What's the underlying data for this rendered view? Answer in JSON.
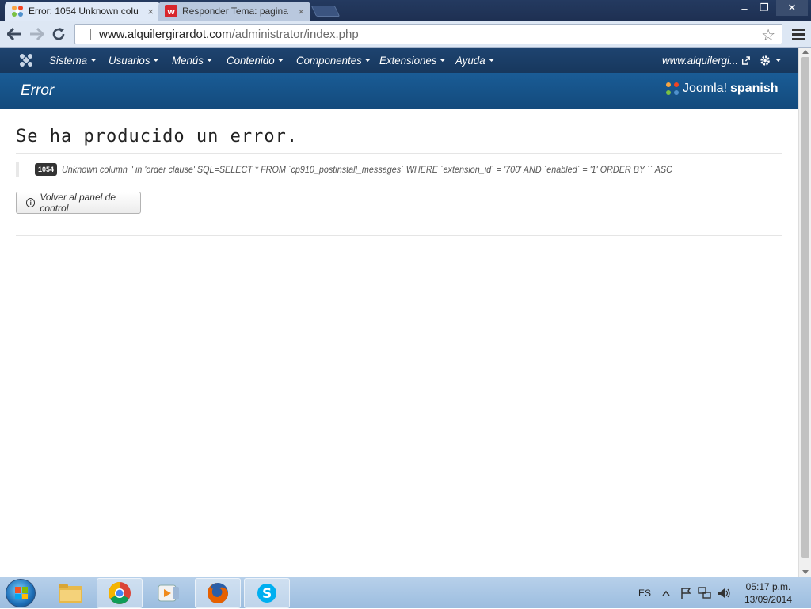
{
  "browser": {
    "tabs": [
      {
        "title": "Error: 1054 Unknown colu",
        "close": "×"
      },
      {
        "title": "Responder Tema: pagina",
        "close": "×"
      }
    ],
    "window_controls": {
      "minimize": "–",
      "maximize": "❐",
      "close": "✕"
    },
    "url_host": "www.alquilergirardot.com",
    "url_path": "/administrator/index.php"
  },
  "joomla_nav": {
    "items": [
      "Sistema",
      "Usuarios",
      "Menús",
      "Contenido",
      "Componentes",
      "Extensiones",
      "Ayuda"
    ],
    "site_link": "www.alquilergi..."
  },
  "subheader": {
    "title": "Error",
    "logo_text_1": "Joomla!",
    "logo_text_2": "spanish"
  },
  "error": {
    "heading": "Se ha producido un error.",
    "code": "1054",
    "message": "Unknown column '' in 'order clause' SQL=SELECT * FROM `cp910_postinstall_messages` WHERE `extension_id` = '700' AND `enabled` = '1' ORDER BY `` ASC",
    "back_button": "Volver al panel de control"
  },
  "taskbar": {
    "lang": "ES",
    "time": "05:17 p.m.",
    "date": "13/09/2014"
  },
  "colors": {
    "joomla_nav": "#17375d",
    "subheader": "#1a5c96",
    "chrome_frame": "#1f2f4a"
  }
}
